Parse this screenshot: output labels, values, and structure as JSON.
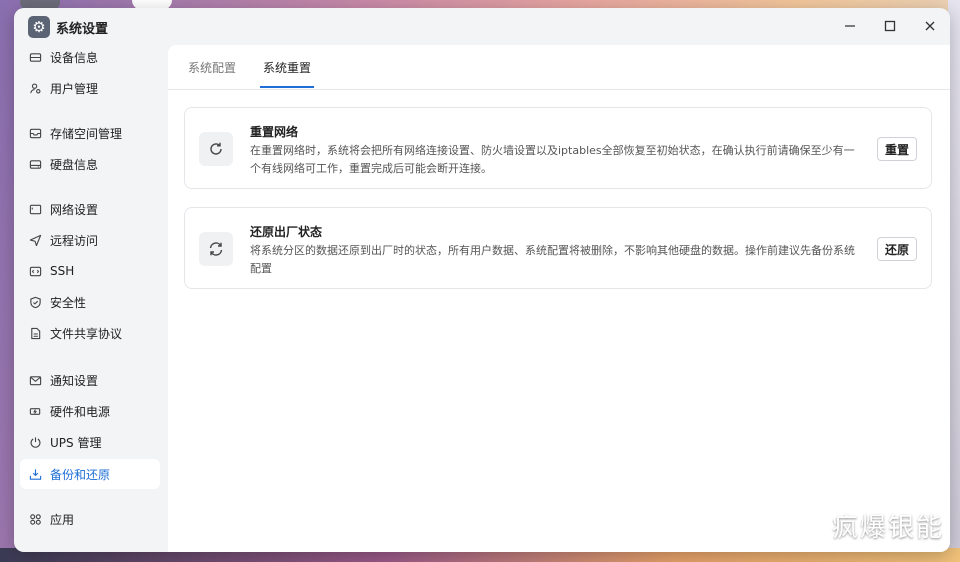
{
  "window": {
    "title": "系统设置"
  },
  "watermark": "疯爆银能",
  "sidebar": {
    "items": [
      {
        "label": "设备信息",
        "icon": "device-icon"
      },
      {
        "label": "用户管理",
        "icon": "users-icon"
      },
      {
        "label": "存储空间管理",
        "icon": "storage-icon"
      },
      {
        "label": "硬盘信息",
        "icon": "disk-icon"
      },
      {
        "label": "网络设置",
        "icon": "network-icon"
      },
      {
        "label": "远程访问",
        "icon": "send-icon"
      },
      {
        "label": "SSH",
        "icon": "ssh-icon"
      },
      {
        "label": "安全性",
        "icon": "shield-icon"
      },
      {
        "label": "文件共享协议",
        "icon": "file-icon"
      },
      {
        "label": "通知设置",
        "icon": "mail-icon"
      },
      {
        "label": "硬件和电源",
        "icon": "power-icon"
      },
      {
        "label": "UPS 管理",
        "icon": "ups-icon"
      },
      {
        "label": "备份和还原",
        "icon": "backup-icon",
        "active": true
      },
      {
        "label": "应用",
        "icon": "apps-icon"
      }
    ]
  },
  "tabs": [
    {
      "label": "系统配置"
    },
    {
      "label": "系统重置",
      "active": true
    }
  ],
  "cards": [
    {
      "title": "重置网络",
      "description": "在重置网络时，系统将会把所有网络连接设置、防火墙设置以及iptables全部恢复至初始状态，在确认执行前请确保至少有一个有线网络可工作，重置完成后可能会断开连接。",
      "button": "重置",
      "icon": "refresh-icon"
    },
    {
      "title": "还原出厂状态",
      "description": "将系统分区的数据还原到出厂时的状态，所有用户数据、系统配置将被删除，不影响其他硬盘的数据。操作前建议先备份系统配置",
      "button": "还原",
      "icon": "restore-icon"
    }
  ],
  "colors": {
    "accent": "#1f6fd6"
  }
}
